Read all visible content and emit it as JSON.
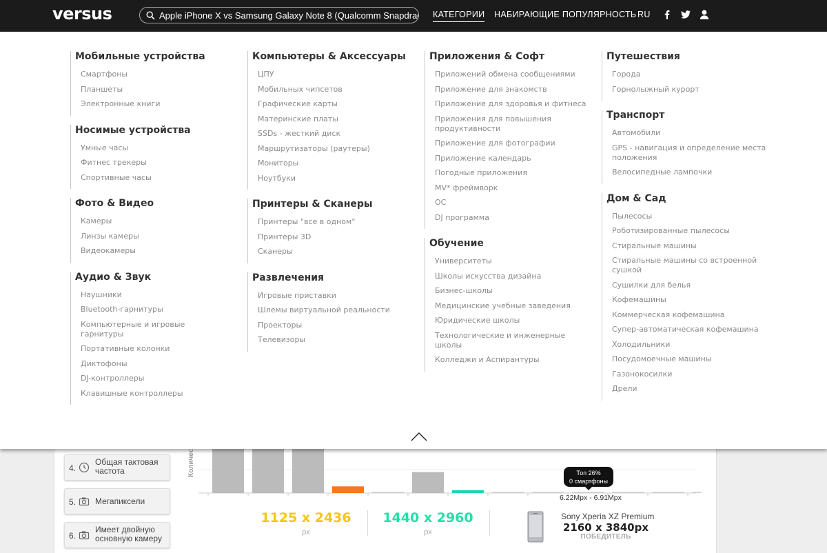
{
  "header": {
    "logo": "versus",
    "search_value": "Apple iPhone X vs Samsung Galaxy Note 8 (Qualcomm Snapdragon 835)",
    "nav": {
      "categories": "КАТЕГОРИИ",
      "trending": "НАБИРАЮЩИЕ ПОПУЛЯРНОСТЬ",
      "lang": "RU"
    }
  },
  "menu": {
    "columns": [
      {
        "groups": [
          {
            "title": "Мобильные устройства",
            "items": [
              "Смартфоны",
              "Планшеты",
              "Электронные книги"
            ]
          },
          {
            "title": "Носимые устройства",
            "items": [
              "Умные часы",
              "Фитнес трекеры",
              "Спортивные часы"
            ]
          },
          {
            "title": "Фото & Видео",
            "items": [
              "Камеры",
              "Линзы камеры",
              "Видеокамеры"
            ]
          },
          {
            "title": "Аудио & Звук",
            "items": [
              "Наушники",
              "Bluetooth-гарнитуры",
              "Компьютерные и игровые гарнитуры",
              "Портативные колонки",
              "Диктофоны",
              "DJ-контроллеры",
              "Клавишные контроллеры"
            ]
          }
        ]
      },
      {
        "groups": [
          {
            "title": "Компьютеры & Аксессуары",
            "items": [
              "ЦПУ",
              "Мобильных чипсетов",
              "Графические карты",
              "Материнские платы",
              "SSDs - жесткий диск",
              "Маршрутизаторы (раутеры)",
              "Мониторы",
              "Ноутбуки"
            ]
          },
          {
            "title": "Принтеры & Сканеры",
            "items": [
              "Принтеры \"все в одном\"",
              "Принтеры 3D",
              "Сканеры"
            ]
          },
          {
            "title": "Развлечения",
            "items": [
              "Игровые приставки",
              "Шлемы виртуальной реальности",
              "Проекторы",
              "Телевизоры"
            ]
          }
        ]
      },
      {
        "groups": [
          {
            "title": "Приложения & Софт",
            "items": [
              "Приложений обмена сообщениями",
              "Приложение для знакомств",
              "Приложение для здоровья и фитнеса",
              "Приложения для повышения продуктивности",
              "Приложение для фотографии",
              "Приложение календарь",
              "Погодные приложения",
              "MV* фреймворк",
              "ОС",
              "DJ программа"
            ]
          },
          {
            "title": "Обучение",
            "items": [
              "Университеты",
              "Школы искусства дизайна",
              "Бизнес-школы",
              "Медицинские учебные заведения",
              "Юридические школы",
              "Технологические и инженерные школы",
              "Колледжи и Аспирантуры"
            ]
          }
        ]
      },
      {
        "groups": [
          {
            "title": "Путешествия",
            "items": [
              "Города",
              "Горнолыжный курорт"
            ]
          },
          {
            "title": "Транспорт",
            "items": [
              "Автомобили",
              "GPS - навигация и определение места положения",
              "Велосипедные лампочки"
            ]
          },
          {
            "title": "Дом & Сад",
            "items": [
              "Пылесосы",
              "Роботизированные пылесосы",
              "Стиральные машины",
              "Стиральные машины со встроенной сушкой",
              "Сушилки для белья",
              "Кофемашины",
              "Коммерческая кофемашина",
              "Супер-автоматическая кофемашина",
              "Холодильники",
              "Посудомоечные машины",
              "Газонокосилки",
              "Дрели"
            ]
          }
        ]
      }
    ]
  },
  "sidebar": [
    {
      "num": "4.",
      "label": "Общая тактовая частота",
      "icon": "clock-icon"
    },
    {
      "num": "5.",
      "label": "Мегапиксели",
      "icon": "camera-icon"
    },
    {
      "num": "6.",
      "label": "Имеет двойную основную камеру",
      "icon": "camera-icon"
    }
  ],
  "chart_data": {
    "type": "bar",
    "ylabel": "Количество",
    "values": [
      100,
      100,
      100,
      14,
      2,
      44,
      6,
      0,
      0,
      0,
      0,
      0,
      2
    ],
    "colors": [
      "#bbbbbb",
      "#bbbbbb",
      "#bbbbbb",
      "#f47920",
      "#cccccc",
      "#bbbbbb",
      "#22d3b6",
      "#cccccc",
      "#cccccc",
      "#cccccc",
      "#cccccc",
      "#cccccc",
      "#cccccc"
    ],
    "tooltip": {
      "line1": "Топ 26%",
      "line2": "0 смартфоны"
    },
    "highlight_range": "6.22Mpx - 6.91Mpx"
  },
  "results": {
    "phone1": {
      "value": "1125 x 2436",
      "unit": "px",
      "color": "#f5c518"
    },
    "phone2": {
      "value": "1440 x 2960",
      "unit": "px",
      "color": "#22e0a8"
    },
    "winner": {
      "name": "Sony Xperia XZ Premium",
      "value": "2160 x 3840px",
      "tag": "ПОБЕДИТЕЛЬ"
    }
  }
}
